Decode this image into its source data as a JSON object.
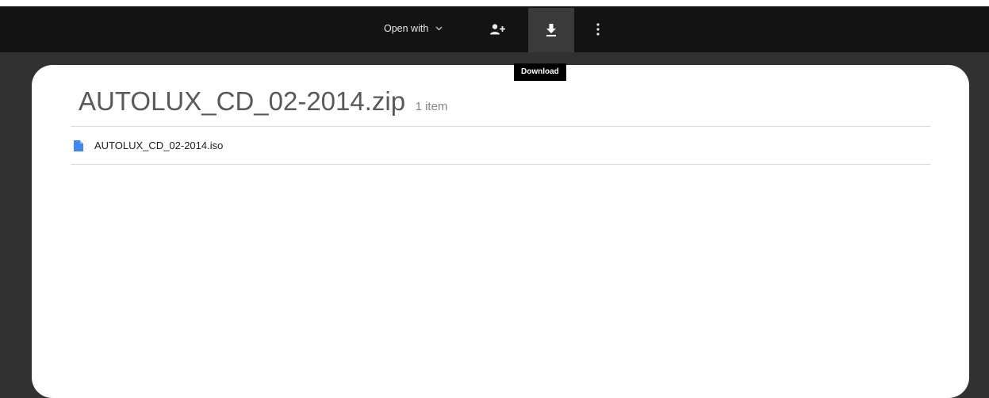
{
  "toolbar": {
    "open_with_label": "Open with",
    "tooltip": "Download",
    "icons": [
      "chevron-down-icon",
      "add-person-icon",
      "download-icon",
      "more-vert-icon"
    ]
  },
  "archive": {
    "name": "AUTOLUX_CD_02-2014.zip",
    "item_count": "1 item"
  },
  "files": [
    {
      "name": "AUTOLUX_CD_02-2014.iso",
      "icon": "file-icon"
    }
  ],
  "colors": {
    "toolbar_bg": "#131313",
    "backdrop": "#313131",
    "file_icon": "#4285f4"
  }
}
